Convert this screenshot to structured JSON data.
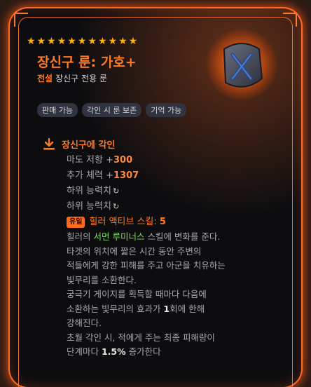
{
  "stars": {
    "count": 11,
    "color": "#ffb000"
  },
  "item": {
    "name": "장신구 룬: 가호+",
    "grade": "전설",
    "category": "장신구 전용 룬"
  },
  "tags": [
    "판매 가능",
    "각인 시 룬 보존",
    "기억 가능"
  ],
  "engrave": {
    "header": "장신구에 각인",
    "stats": [
      {
        "label": "마도 저항 +",
        "value": "300"
      },
      {
        "label": "추가 체력 +",
        "value": "1307"
      }
    ],
    "sub_stats": [
      "하위 능력치",
      "하위 능력치"
    ],
    "unique": {
      "badge": "유일",
      "text": "힐러 액티브 스킬: ",
      "value": "5"
    },
    "description": {
      "p1_before": "힐러의 ",
      "p1_highlight": "서먼 루미너스",
      "p1_after": " 스킬에 변화를 준다.",
      "p2": "타겟의 위치에 짧은 시간 동안 주변의",
      "p3": "적들에게 강한 피해를 주고 아군을 치유하는",
      "p4": "빛무리를 소환한다.",
      "p5": "궁극기 게이지를 획득할 때마다 다음에",
      "p6_before": "소환하는 빛무리의 효과가 ",
      "p6_bold": "1",
      "p6_after": "회에 한해",
      "p7": "강해진다.",
      "p8": "초월 각인 시, 적에게 주는 최종 피해량이",
      "p9_before": "단계마다 ",
      "p9_bold": "1.5%",
      "p9_after": " 증가한다"
    }
  },
  "icons": {
    "engrave": "download-arrow-icon",
    "refresh": "refresh-icon",
    "rune": "rune-stone-icon"
  },
  "colors": {
    "accent": "#ff7a22",
    "highlight": "#7adf5a",
    "frame_glow": "#ff6a24"
  }
}
